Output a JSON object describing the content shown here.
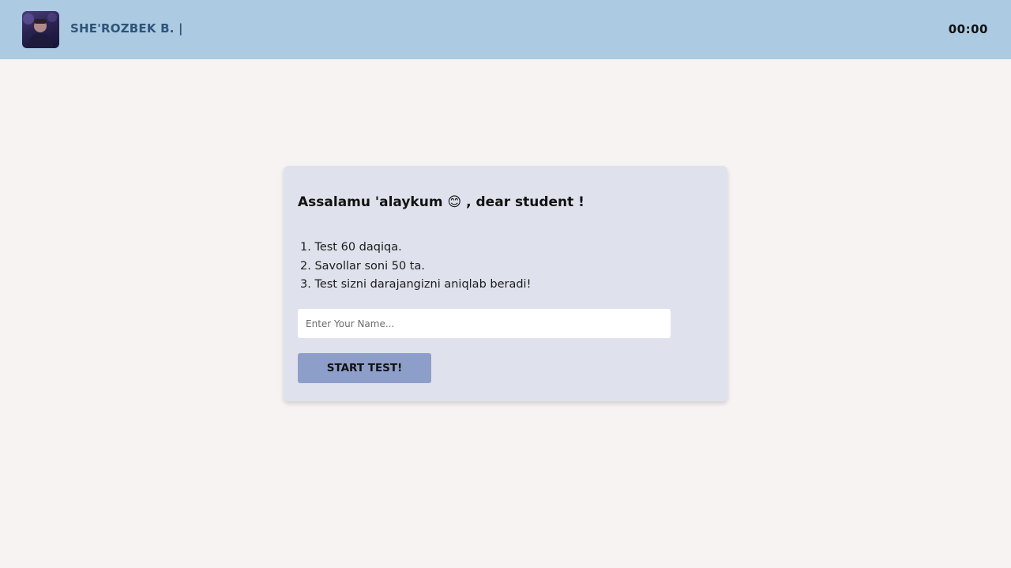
{
  "header": {
    "brand_name": "SHE'ROZBEK B. |",
    "timer": "00:00",
    "colors": {
      "bar": "#accbe2",
      "brand_text": "#2f5479"
    }
  },
  "welcome_card": {
    "greeting_before_emoji": "Assalamu 'alaykum",
    "greeting_emoji": "😊",
    "greeting_after_emoji": ", dear student !",
    "rules": [
      "1. Test 60 daqiqa.",
      "2. Savollar soni 50 ta.",
      "3. Test sizni darajangizni aniqlab beradi!"
    ],
    "name_input": {
      "value": "",
      "placeholder": "Enter Your Name..."
    },
    "start_button_label": "START TEST!",
    "colors": {
      "card": "#dfe2ec",
      "button": "#8d9ec8",
      "page_background": "#f7f3f2"
    }
  }
}
